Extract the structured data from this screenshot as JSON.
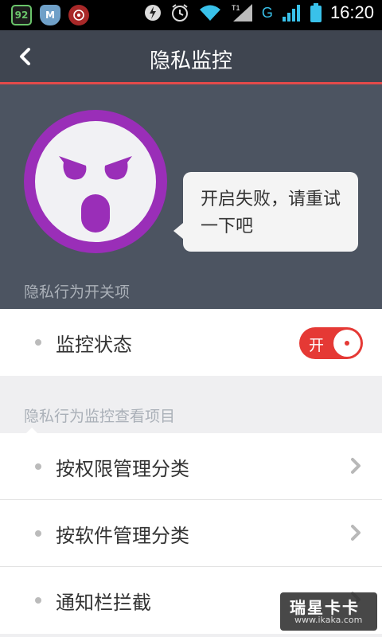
{
  "status_bar": {
    "app_icon_1": "92",
    "app_icon_2": "M",
    "network": "G",
    "time": "16:20",
    "icons": [
      "app-92-icon",
      "shield-m-icon",
      "red-badge-icon",
      "lightning-icon",
      "alarm-icon",
      "wifi-icon",
      "signal-icon",
      "signal-icon",
      "battery-icon"
    ]
  },
  "header": {
    "title": "隐私监控",
    "back_icon": "chevron-left-icon"
  },
  "hero": {
    "face_icon": "angry-face-icon",
    "message": "开启失败，请重试一下吧",
    "section_label": "隐私行为开关项"
  },
  "monitor": {
    "label": "监控状态",
    "toggle_text": "开",
    "toggle_on": true
  },
  "section2": {
    "label": "隐私行为监控查看项目"
  },
  "items": [
    {
      "label": "按权限管理分类",
      "icon": "chevron-right-icon"
    },
    {
      "label": "按软件管理分类",
      "icon": "chevron-right-icon"
    },
    {
      "label": "通知栏拦截",
      "icon": "chevron-right-icon"
    }
  ],
  "watermark": {
    "brand": "瑞星卡卡",
    "url": "www.ikaka.com"
  },
  "colors": {
    "header_bg": "#3f4550",
    "hero_bg": "#4c5461",
    "accent_red": "#e53935",
    "face_purple": "#9a2eb8"
  }
}
